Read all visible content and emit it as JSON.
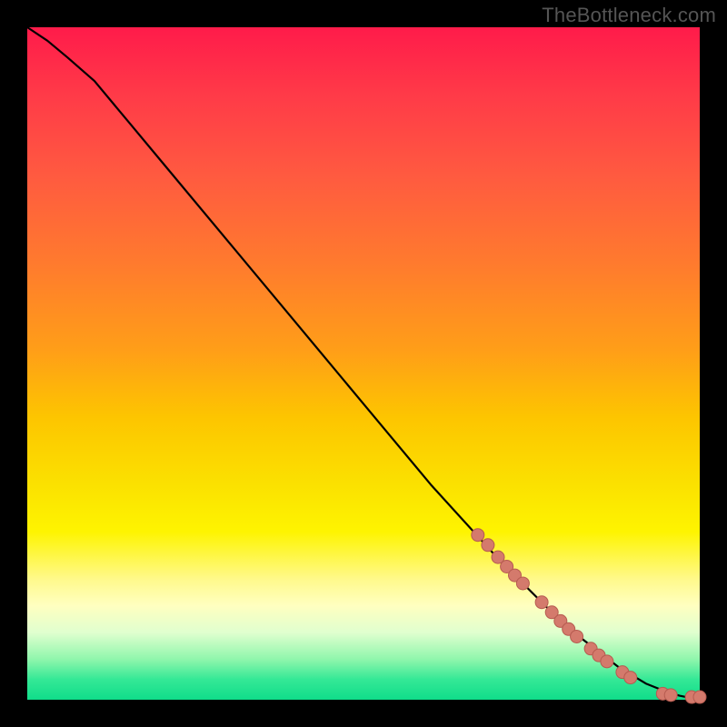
{
  "watermark": "TheBottleneck.com",
  "colors": {
    "page_bg": "#000000",
    "curve": "#000000",
    "dot_fill": "#d47a6c",
    "dot_stroke": "#b65b50",
    "gradient_top": "#ff1b4a",
    "gradient_bottom": "#10dd8a"
  },
  "chart_data": {
    "type": "line",
    "title": "",
    "xlabel": "",
    "ylabel": "",
    "xlim": [
      0,
      100
    ],
    "ylim": [
      0,
      100
    ],
    "grid": false,
    "legend": false,
    "curve": {
      "x": [
        0,
        3,
        6,
        10,
        15,
        20,
        30,
        40,
        50,
        60,
        70,
        80,
        88,
        92,
        95,
        97,
        98,
        100
      ],
      "y": [
        100,
        98,
        95.5,
        92,
        86,
        80,
        68,
        56,
        44,
        32,
        21,
        11,
        4.8,
        2.4,
        1.2,
        0.6,
        0.4,
        0.4
      ]
    },
    "points": [
      {
        "x": 67,
        "y": 24.5
      },
      {
        "x": 68.5,
        "y": 23
      },
      {
        "x": 70,
        "y": 21.2
      },
      {
        "x": 71.3,
        "y": 19.8
      },
      {
        "x": 72.5,
        "y": 18.5
      },
      {
        "x": 73.7,
        "y": 17.3
      },
      {
        "x": 76.5,
        "y": 14.5
      },
      {
        "x": 78,
        "y": 13.0
      },
      {
        "x": 79.3,
        "y": 11.7
      },
      {
        "x": 80.5,
        "y": 10.5
      },
      {
        "x": 81.7,
        "y": 9.4
      },
      {
        "x": 83.8,
        "y": 7.6
      },
      {
        "x": 85,
        "y": 6.6
      },
      {
        "x": 86.2,
        "y": 5.7
      },
      {
        "x": 88.5,
        "y": 4.1
      },
      {
        "x": 89.7,
        "y": 3.3
      },
      {
        "x": 94.5,
        "y": 0.9
      },
      {
        "x": 95.7,
        "y": 0.7
      },
      {
        "x": 98.8,
        "y": 0.4
      },
      {
        "x": 100,
        "y": 0.4
      }
    ],
    "point_radius_px": 7
  }
}
